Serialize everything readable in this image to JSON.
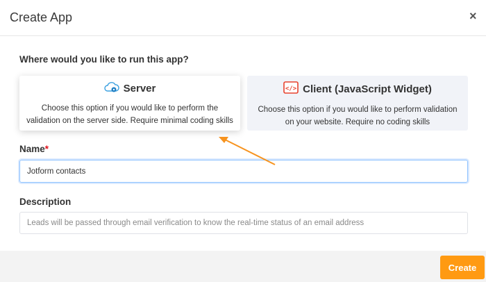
{
  "dialog": {
    "title": "Create App",
    "close_icon": "×"
  },
  "question": "Where would you like to run this app?",
  "options": [
    {
      "title": "Server",
      "icon": "cloud-gear-icon",
      "description": "Choose this option if you would like to perform the validation on the server side. Require minimal coding skills",
      "selected": true
    },
    {
      "title": "Client (JavaScript Widget)",
      "icon": "code-icon",
      "description": "Choose this option if you would like to perform validation on your website. Require no coding skills",
      "selected": false
    }
  ],
  "name": {
    "label": "Name",
    "required_mark": "*",
    "value": "Jotform contacts"
  },
  "description": {
    "label": "Description",
    "placeholder": "Leads will be passed through email verification to know the real-time status of an email address"
  },
  "footer": {
    "create_label": "Create"
  },
  "colors": {
    "accent": "#ff9a12",
    "annotation_arrow": "#f7931e",
    "code_icon": "#e8412c",
    "focus_border": "#8dc2ff"
  }
}
